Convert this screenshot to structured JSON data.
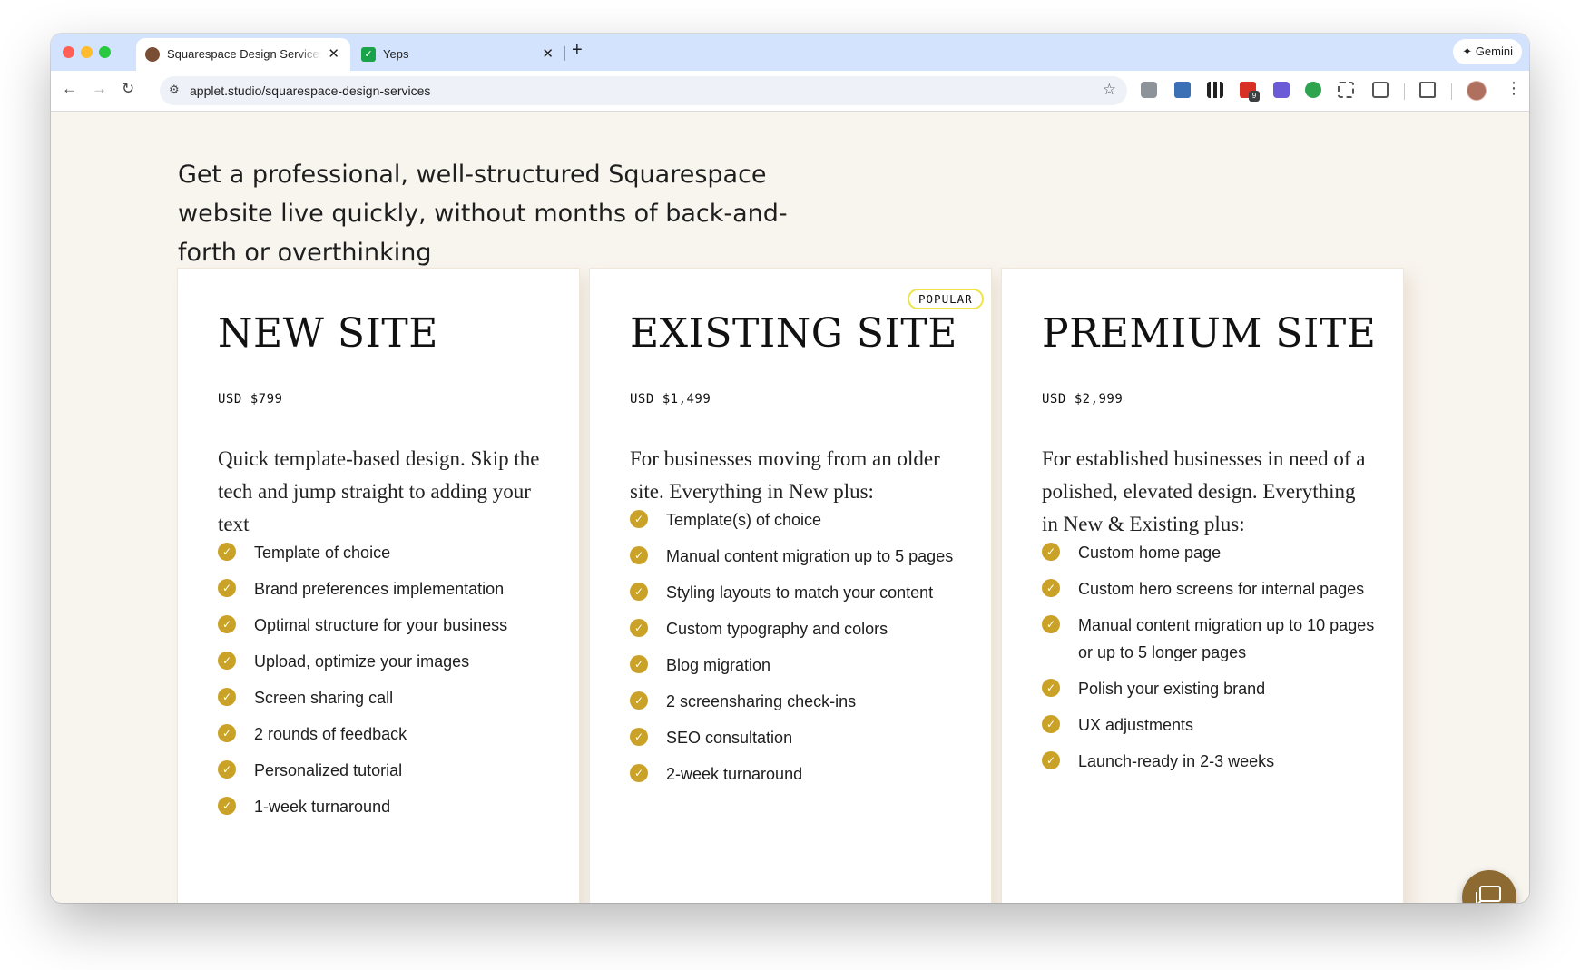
{
  "browser": {
    "tabs": [
      {
        "title": "Squarespace Design Services",
        "active": true
      },
      {
        "title": "Yeps",
        "active": false
      }
    ],
    "new_tab_label": "+",
    "gemini_label": "Gemini",
    "url": "applet.studio/squarespace-design-services",
    "extension_badge": "9",
    "colors": {
      "tabstrip": "#d3e3fd",
      "toolbar": "#ffffff"
    }
  },
  "page": {
    "headline": "Get a professional, well-structured Squarespace website live quickly, without months of back-and-forth or overthinking",
    "background": "#f8f4ee",
    "accent": "#c9a227",
    "plans": [
      {
        "title": "NEW SITE",
        "price": "USD $799",
        "description": "Quick template-based design. Skip the tech and jump straight to adding your text",
        "badge": "",
        "features": [
          "Template of choice",
          "Brand preferences implementation",
          "Optimal structure for your business",
          "Upload, optimize your images",
          "Screen sharing call",
          "2 rounds of feedback",
          "Personalized tutorial",
          "1-week turnaround"
        ]
      },
      {
        "title": "EXISTING SITE",
        "price": "USD $1,499",
        "description": "For businesses moving from an older site. Everything in New plus:",
        "badge": "POPULAR",
        "features": [
          "Template(s) of choice",
          "Manual content migration up to 5 pages",
          "Styling layouts to match your content",
          "Custom typography and colors",
          "Blog migration",
          "2 screensharing check-ins",
          "SEO consultation",
          "2-week turnaround"
        ]
      },
      {
        "title": "PREMIUM SITE",
        "price": "USD $2,999",
        "description": "For established businesses in need of a polished, elevated design. Everything in New & Existing plus:",
        "badge": "",
        "features": [
          "Custom home page",
          "Custom hero screens for internal pages",
          "Manual content migration up to 10 pages or up to 5 longer pages",
          "Polish your existing brand",
          "UX adjustments",
          "Launch-ready in 2-3 weeks"
        ]
      }
    ],
    "chat_button_icon": "chat-bubble-icon"
  }
}
